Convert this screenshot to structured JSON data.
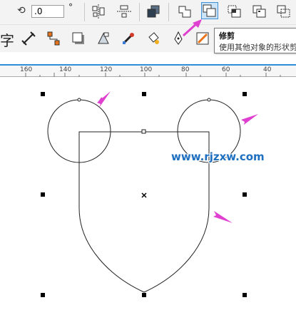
{
  "toolbar1": {
    "angle_value": ".0",
    "degree_symbol": "°",
    "buttons": [
      "align-icon",
      "distribute-icon",
      "arrange-icon",
      "weld-icon",
      "trim-icon",
      "intersect-icon",
      "simplify-icon",
      "front-minus-back-icon"
    ]
  },
  "toolbar2": {
    "partial_label": "字"
  },
  "tooltip": {
    "title": "修剪",
    "description": "使用其他对象的形状剪"
  },
  "ruler": {
    "labels": [
      "160",
      "140",
      "120",
      "100",
      "80",
      "60",
      "40"
    ]
  },
  "watermark": "www.rjzxw.com",
  "annotation_color": "#e040d0",
  "selection_color": "#000000"
}
